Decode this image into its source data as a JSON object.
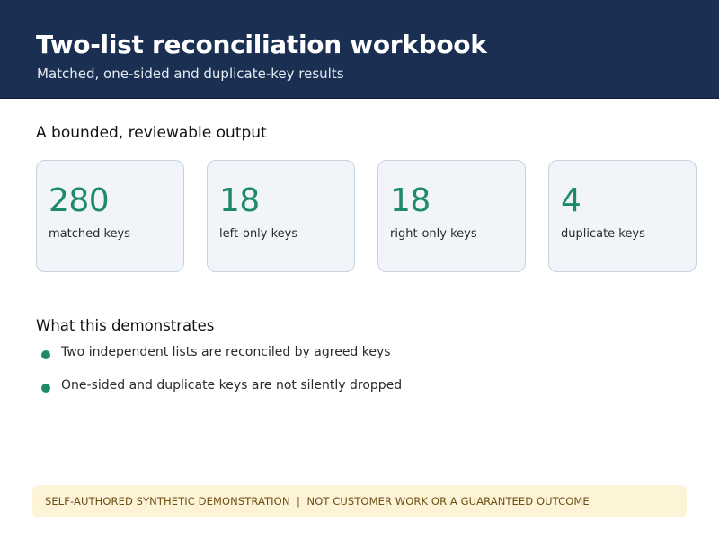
{
  "header": {
    "title": "Two-list reconciliation workbook",
    "subtitle": "Matched, one-sided and duplicate-key results"
  },
  "summary": {
    "heading": "A bounded, reviewable output",
    "cards": [
      {
        "value": "280",
        "label": "matched keys"
      },
      {
        "value": "18",
        "label": "left-only keys"
      },
      {
        "value": "18",
        "label": "right-only keys"
      },
      {
        "value": "4",
        "label": "duplicate keys"
      }
    ]
  },
  "demonstrates": {
    "heading": "What this demonstrates",
    "items": [
      "Two independent lists are reconciled by agreed keys",
      "One-sided and duplicate keys are not silently dropped"
    ]
  },
  "footer": {
    "disclaimer": "SELF-AUTHORED SYNTHETIC DEMONSTRATION  |  NOT CUSTOMER WORK OR A GUARANTEED OUTCOME"
  },
  "colors": {
    "header_bg": "#1b2f52",
    "accent": "#1e8a6a",
    "card_bg": "#f1f4f8",
    "footer_bg": "#fdf3d7"
  }
}
